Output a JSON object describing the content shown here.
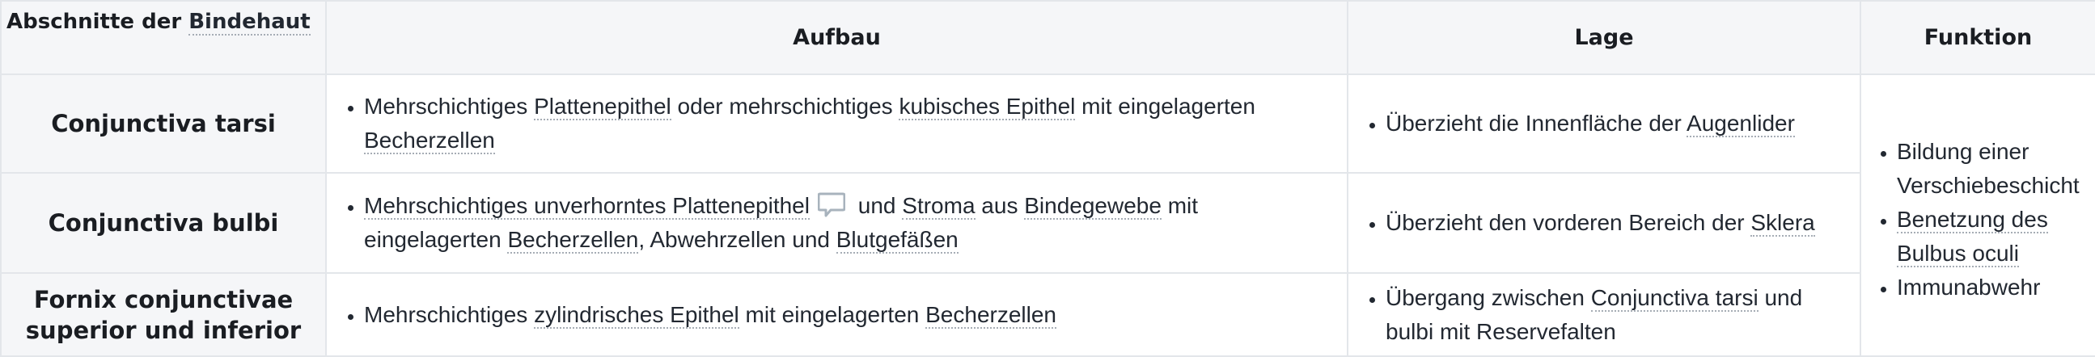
{
  "table": {
    "headers": {
      "col1_prefix": "Abschnitte der",
      "col1_link": "Bindehaut",
      "col2": "Aufbau",
      "col3": "Lage",
      "col4": "Funktion"
    },
    "rows": [
      {
        "label": "Conjunctiva tarsi",
        "aufbau": {
          "t1": "Mehrschichtiges ",
          "l1": "Plattenepithel",
          "t2": " oder mehrschichtiges ",
          "l2": "kubisches Epithel",
          "t3": " mit eingelagerten ",
          "l3": "Becherzellen"
        },
        "lage": {
          "t1": "Überzieht die Innenfläche der ",
          "l1": "Augenlider"
        }
      },
      {
        "label": "Conjunctiva bulbi",
        "aufbau": {
          "l1": "Mehrschichtiges unverhorntes Plattenepithel",
          "icon": "comment-icon",
          "t1": " und ",
          "l2": "Stroma",
          "t2": " aus ",
          "l3": "Bindegewebe",
          "t3": " mit eingelagerten ",
          "l4": "Becherzellen",
          "t4": ", Abwehrzellen und ",
          "l5": "Blutgefäßen"
        },
        "lage": {
          "t1": "Überzieht den vorderen Bereich der ",
          "l1": "Sklera"
        }
      },
      {
        "label_line1": "Fornix conjunctivae",
        "label_line2": "superior und inferior",
        "aufbau": {
          "t1": "Mehrschichtiges ",
          "l1": "zylindrisches Epithel",
          "t2": " mit eingelagerten ",
          "l2": "Becherzellen"
        },
        "lage": {
          "t1": "Übergang zwischen ",
          "l1": "Conjunctiva tarsi",
          "t2": " und bulbi mit Reservefalten"
        }
      }
    ],
    "funktion": {
      "items": [
        {
          "text": "Bildung einer Verschiebeschicht"
        },
        {
          "link": "Benetzung des Bulbus oculi"
        },
        {
          "text": "Immunabwehr"
        }
      ]
    },
    "colors": {
      "header_bg": "#f5f6f8",
      "border": "#e3e6ea",
      "link_underline": "#a6adb5",
      "icon": "#a8b3bd"
    }
  }
}
